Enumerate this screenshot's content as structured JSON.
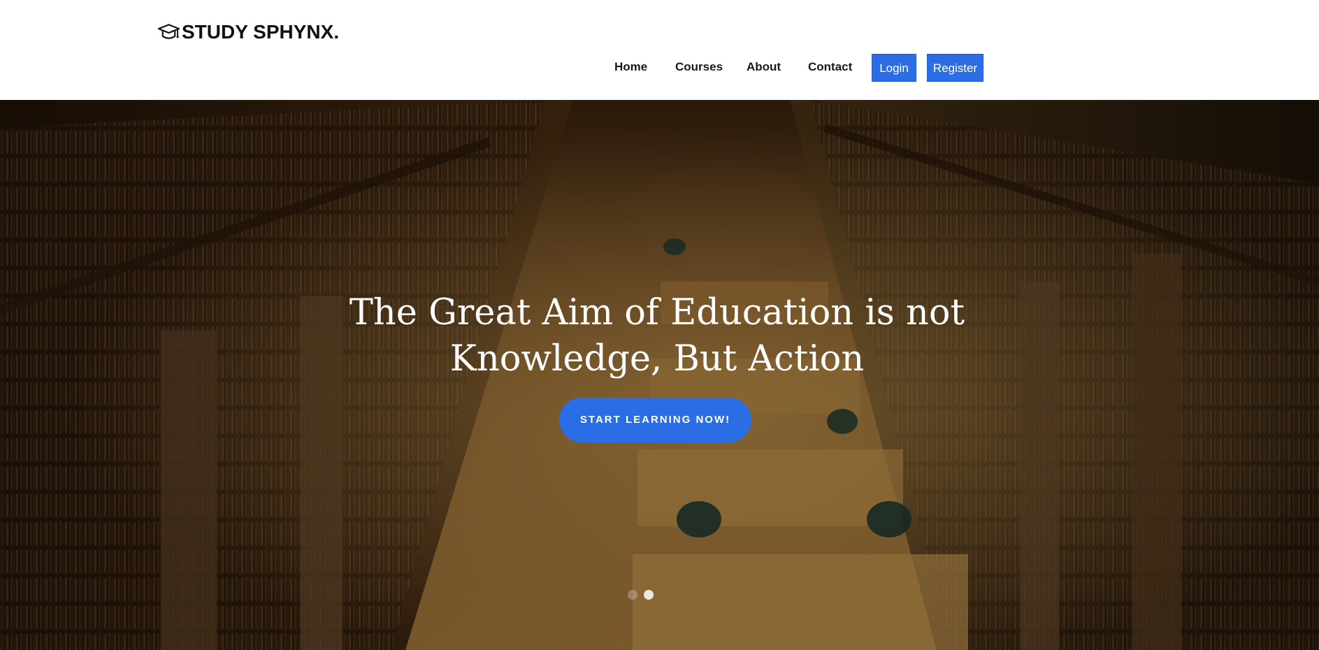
{
  "brand": {
    "name": "STUDY SPHYNX."
  },
  "nav": {
    "home": "Home",
    "courses": "Courses",
    "about": "About",
    "contact": "Contact",
    "login": "Login",
    "register": "Register"
  },
  "hero": {
    "headline_line1": "The Great Aim of Education is not",
    "headline_line2": "Knowledge, But Action",
    "cta": "START LEARNING NOW!",
    "carousel": {
      "slides": 2,
      "active_slide": 2
    }
  },
  "colors": {
    "accent": "#2b6de5",
    "header_bg": "#ffffff",
    "text": "#111111"
  },
  "icons": {
    "logo": "graduation-cap-icon"
  }
}
